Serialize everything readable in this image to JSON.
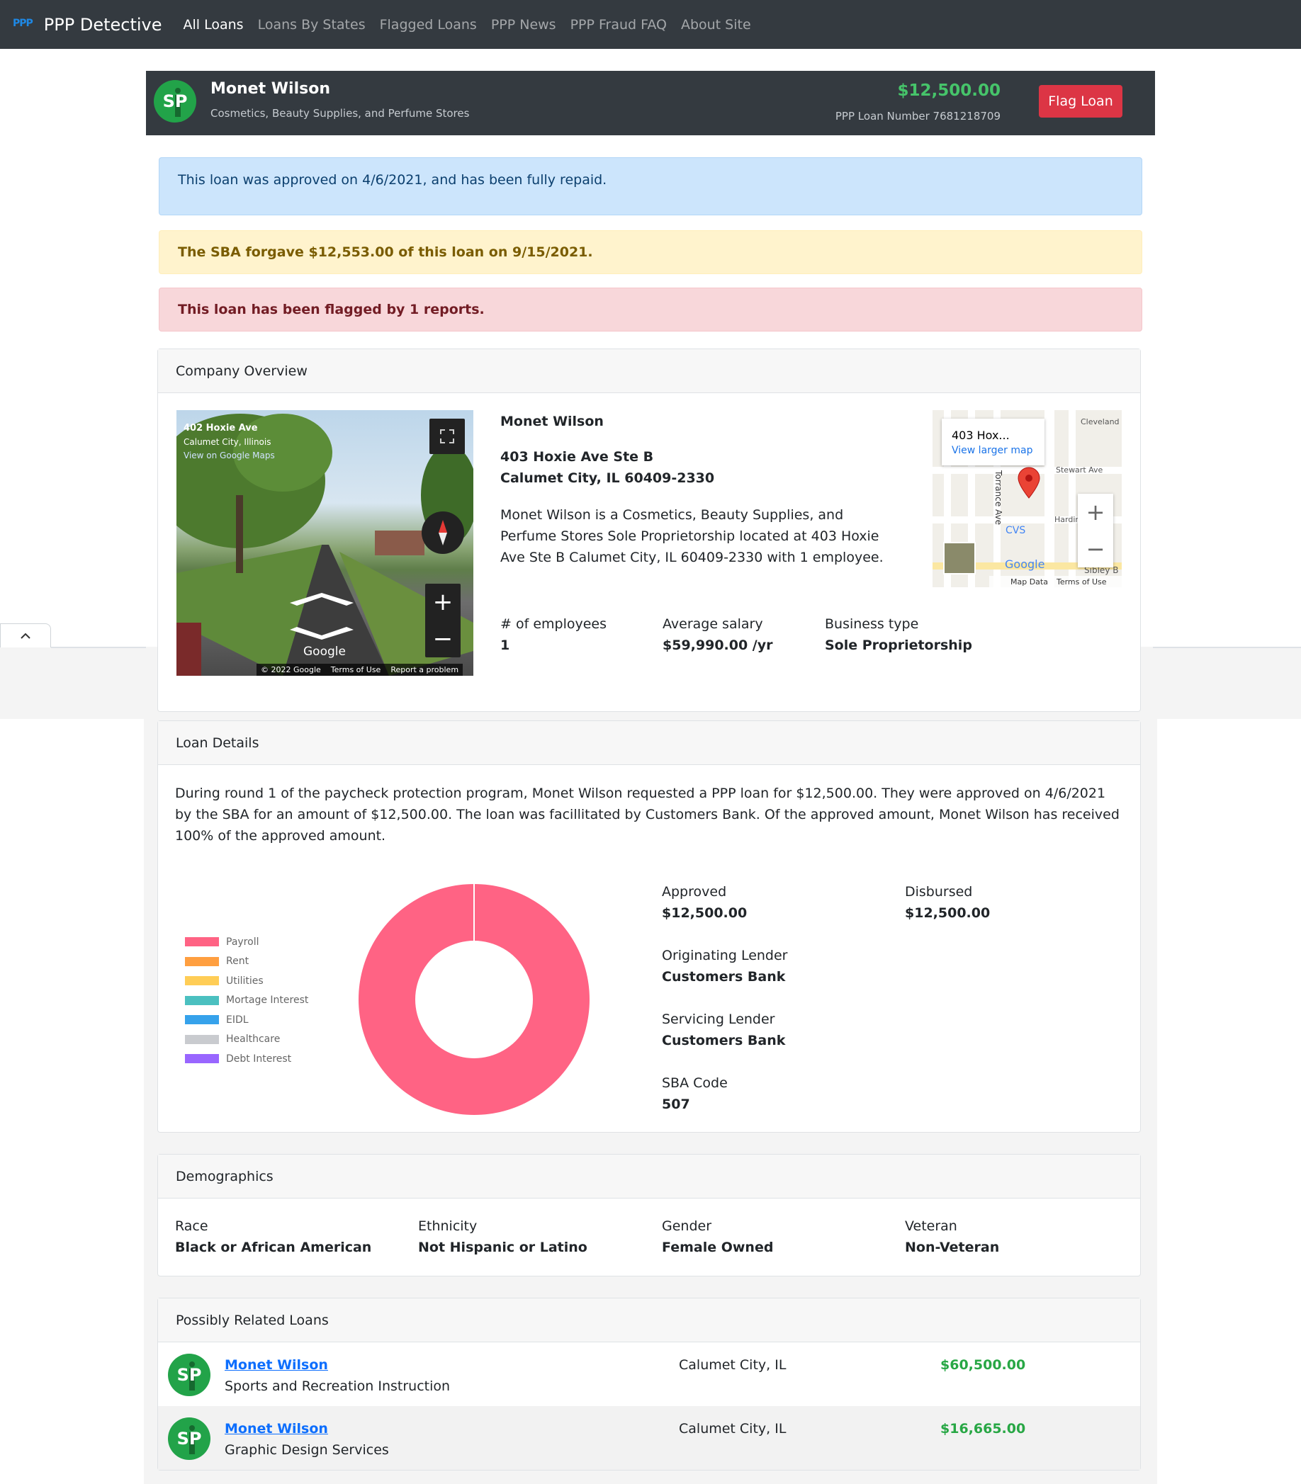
{
  "nav": {
    "logo": "PPP",
    "brand": "PPP Detective",
    "links": [
      "All Loans",
      "Loans By States",
      "Flagged Loans",
      "PPP News",
      "PPP Fraud FAQ",
      "About Site"
    ]
  },
  "header": {
    "initials": "SP",
    "name": "Monet Wilson",
    "industry": "Cosmetics, Beauty Supplies, and Perfume Stores",
    "amount": "$12,500.00",
    "loan_number": "PPP Loan Number 7681218709",
    "flag_button": "Flag Loan"
  },
  "alerts": {
    "info": "This loan was approved on 4/6/2021, and has been fully repaid.",
    "warning": "The SBA forgave $12,553.00 of this loan on 9/15/2021.",
    "danger": "This loan has been flagged by 1 reports."
  },
  "overview": {
    "title": "Company Overview",
    "streetview": {
      "place": "402 Hoxie Ave",
      "city": "Calumet City, Illinois",
      "link": "View on Google Maps",
      "brand": "Google",
      "copyright": "© 2022 Google",
      "terms": "Terms of Use",
      "report": "Report a problem"
    },
    "name": "Monet Wilson",
    "address1": "403 Hoxie Ave Ste B",
    "address2": "Calumet City, IL 60409-2330",
    "description": "Monet Wilson is a Cosmetics, Beauty Supplies, and Perfume Stores Sole Proprietorship located at 403 Hoxie Ave Ste B Calumet City, IL 60409-2330 with 1 employee.",
    "stats": {
      "employees_label": "# of employees",
      "employees": "1",
      "salary_label": "Average salary",
      "salary": "$59,990.00 /yr",
      "type_label": "Business type",
      "type": "Sole Proprietorship"
    },
    "map": {
      "title": "403 Hox...",
      "link": "View larger map",
      "labels": [
        "Cleveland",
        "Stewart Ave",
        "Torrance Ave",
        "Hardin",
        "CVS",
        "Sibley B"
      ],
      "brand": "Google",
      "data": "Map Data",
      "terms": "Terms of Use"
    }
  },
  "loan_details": {
    "title": "Loan Details",
    "summary": "During round 1 of the paycheck protection program, Monet Wilson requested a PPP loan for $12,500.00. They were approved on 4/6/2021 by the SBA for an amount of $12,500.00. The loan was facillitated by Customers Bank. Of the approved amount, Monet Wilson has received 100% of the approved amount.",
    "approved_label": "Approved",
    "approved": "$12,500.00",
    "disbursed_label": "Disbursed",
    "disbursed": "$12,500.00",
    "orig_lender_label": "Originating Lender",
    "orig_lender": "Customers Bank",
    "serv_lender_label": "Servicing Lender",
    "serv_lender": "Customers Bank",
    "sba_code_label": "SBA Code",
    "sba_code": "507"
  },
  "chart_data": {
    "type": "pie",
    "categories": [
      "Payroll",
      "Rent",
      "Utilities",
      "Mortage Interest",
      "EIDL",
      "Healthcare",
      "Debt Interest"
    ],
    "values": [
      12500,
      0,
      0,
      0,
      0,
      0,
      0
    ],
    "colors": [
      "#ff6384",
      "#ff9f40",
      "#ffcd56",
      "#4bc0c0",
      "#36a2eb",
      "#c9cbcf",
      "#9966ff"
    ],
    "legend": "left",
    "donut": true
  },
  "demographics": {
    "title": "Demographics",
    "race_label": "Race",
    "race": "Black or African American",
    "ethnicity_label": "Ethnicity",
    "ethnicity": "Not Hispanic or Latino",
    "gender_label": "Gender",
    "gender": "Female Owned",
    "veteran_label": "Veteran",
    "veteran": "Non-Veteran"
  },
  "related": {
    "title": "Possibly Related Loans",
    "items": [
      {
        "initials": "SP",
        "name": "Monet Wilson",
        "industry": "Sports and Recreation Instruction",
        "city": "Calumet City, IL",
        "amount": "$60,500.00"
      },
      {
        "initials": "SP",
        "name": "Monet Wilson",
        "industry": "Graphic Design Services",
        "city": "Calumet City, IL",
        "amount": "$16,665.00"
      }
    ]
  },
  "colors": {
    "navbar": "#343a40",
    "avatar": "#22a349",
    "amount_green": "#46c46a",
    "flag_red": "#dc3545",
    "link_blue": "#0d6efd"
  }
}
